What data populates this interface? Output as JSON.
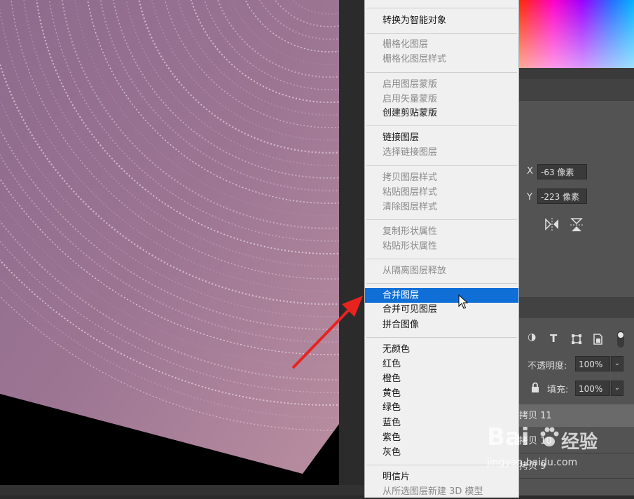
{
  "context_menu": {
    "items": [
      {
        "label": "转换为智能对象",
        "state": "enabled"
      },
      {
        "label": "栅格化图层",
        "state": "disabled"
      },
      {
        "label": "栅格化图层样式",
        "state": "disabled"
      },
      {
        "label": "启用图层蒙版",
        "state": "disabled"
      },
      {
        "label": "启用矢量蒙版",
        "state": "disabled"
      },
      {
        "label": "创建剪贴蒙版",
        "state": "enabled"
      },
      {
        "label": "链接图层",
        "state": "enabled"
      },
      {
        "label": "选择链接图层",
        "state": "disabled"
      },
      {
        "label": "拷贝图层样式",
        "state": "disabled"
      },
      {
        "label": "粘贴图层样式",
        "state": "disabled"
      },
      {
        "label": "清除图层样式",
        "state": "disabled"
      },
      {
        "label": "复制形状属性",
        "state": "disabled"
      },
      {
        "label": "粘贴形状属性",
        "state": "disabled"
      },
      {
        "label": "从隔离图层释放",
        "state": "disabled"
      },
      {
        "label": "合并图层",
        "state": "highlighted"
      },
      {
        "label": "合并可见图层",
        "state": "enabled"
      },
      {
        "label": "拼合图像",
        "state": "enabled"
      },
      {
        "label": "无颜色",
        "state": "enabled"
      },
      {
        "label": "红色",
        "state": "enabled"
      },
      {
        "label": "橙色",
        "state": "enabled"
      },
      {
        "label": "黄色",
        "state": "enabled"
      },
      {
        "label": "绿色",
        "state": "enabled"
      },
      {
        "label": "蓝色",
        "state": "enabled"
      },
      {
        "label": "紫色",
        "state": "enabled"
      },
      {
        "label": "灰色",
        "state": "enabled"
      },
      {
        "label": "明信片",
        "state": "enabled"
      },
      {
        "label": "从所选图层新建 3D 模型",
        "state": "disabled"
      }
    ]
  },
  "properties": {
    "x_label": "X",
    "x_value": "-63 像素",
    "y_label": "Y",
    "y_value": "-223 像素"
  },
  "layers": {
    "opacity_label": "不透明度:",
    "opacity_value": "100%",
    "fill_label": "填充:",
    "fill_value": "100%",
    "rows": [
      "拷贝 11",
      "拷贝 10",
      "拷贝 9"
    ]
  },
  "watermark": {
    "brand": "Bai",
    "brand_suffix": "经验",
    "url": "jingyan.baidu.com"
  },
  "colors": {
    "menu_highlight": "#0f6fd6",
    "annotation_arrow": "#e8231f"
  },
  "icons": [
    "text-tool-icon",
    "transform-icon",
    "smart-object-icon",
    "lock-icon",
    "adjustment-icon",
    "flip-horizontal-icon",
    "flip-vertical-icon",
    "cursor-icon",
    "red-arrow-icon"
  ]
}
